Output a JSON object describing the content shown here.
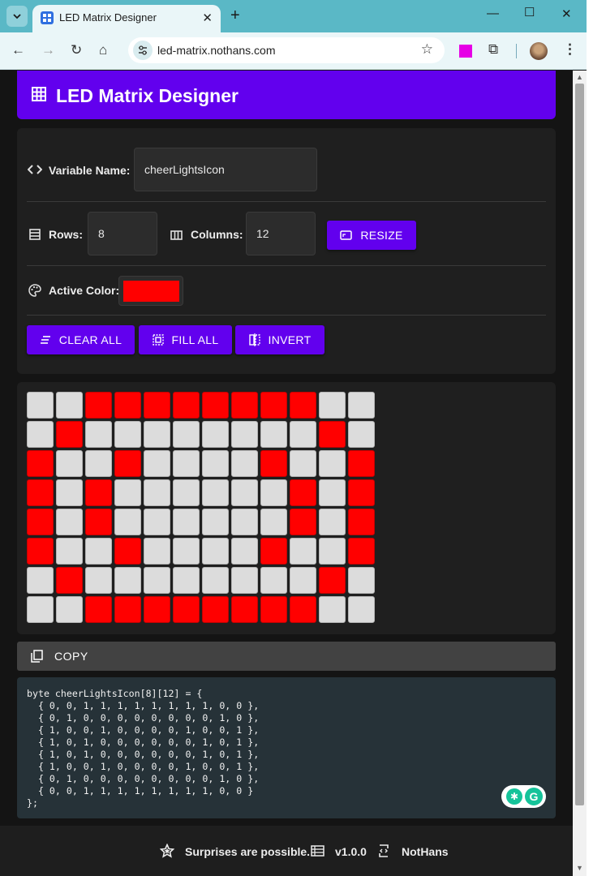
{
  "browser": {
    "tab_title": "LED Matrix Designer",
    "url": "led-matrix.nothans.com"
  },
  "app": {
    "title": "LED Matrix Designer"
  },
  "controls": {
    "variable_label": "Variable Name:",
    "variable_value": "cheerLightsIcon",
    "rows_label": "Rows:",
    "rows_value": "8",
    "columns_label": "Columns:",
    "columns_value": "12",
    "resize_label": "RESIZE",
    "active_color_label": "Active Color:",
    "active_color": "#ff0000",
    "clear_all_label": "CLEAR ALL",
    "fill_all_label": "FILL ALL",
    "invert_label": "INVERT"
  },
  "matrix": {
    "on_color": "#ff0000",
    "off_color": "#dcdcdc",
    "rows": [
      [
        0,
        0,
        1,
        1,
        1,
        1,
        1,
        1,
        1,
        1,
        0,
        0
      ],
      [
        0,
        1,
        0,
        0,
        0,
        0,
        0,
        0,
        0,
        0,
        1,
        0
      ],
      [
        1,
        0,
        0,
        1,
        0,
        0,
        0,
        0,
        1,
        0,
        0,
        1
      ],
      [
        1,
        0,
        1,
        0,
        0,
        0,
        0,
        0,
        0,
        1,
        0,
        1
      ],
      [
        1,
        0,
        1,
        0,
        0,
        0,
        0,
        0,
        0,
        1,
        0,
        1
      ],
      [
        1,
        0,
        0,
        1,
        0,
        0,
        0,
        0,
        1,
        0,
        0,
        1
      ],
      [
        0,
        1,
        0,
        0,
        0,
        0,
        0,
        0,
        0,
        0,
        1,
        0
      ],
      [
        0,
        0,
        1,
        1,
        1,
        1,
        1,
        1,
        1,
        1,
        0,
        0
      ]
    ]
  },
  "copy": {
    "label": "COPY"
  },
  "code": {
    "text": "byte cheerLightsIcon[8][12] = {\n  { 0, 0, 1, 1, 1, 1, 1, 1, 1, 1, 0, 0 },\n  { 0, 1, 0, 0, 0, 0, 0, 0, 0, 0, 1, 0 },\n  { 1, 0, 0, 1, 0, 0, 0, 0, 1, 0, 0, 1 },\n  { 1, 0, 1, 0, 0, 0, 0, 0, 0, 1, 0, 1 },\n  { 1, 0, 1, 0, 0, 0, 0, 0, 0, 1, 0, 1 },\n  { 1, 0, 0, 1, 0, 0, 0, 0, 1, 0, 0, 1 },\n  { 0, 1, 0, 0, 0, 0, 0, 0, 0, 0, 1, 0 },\n  { 0, 0, 1, 1, 1, 1, 1, 1, 1, 1, 0, 0 }\n};"
  },
  "footer": {
    "tagline": "Surprises are possible.",
    "version": "v1.0.0",
    "author": "NotHans"
  }
}
